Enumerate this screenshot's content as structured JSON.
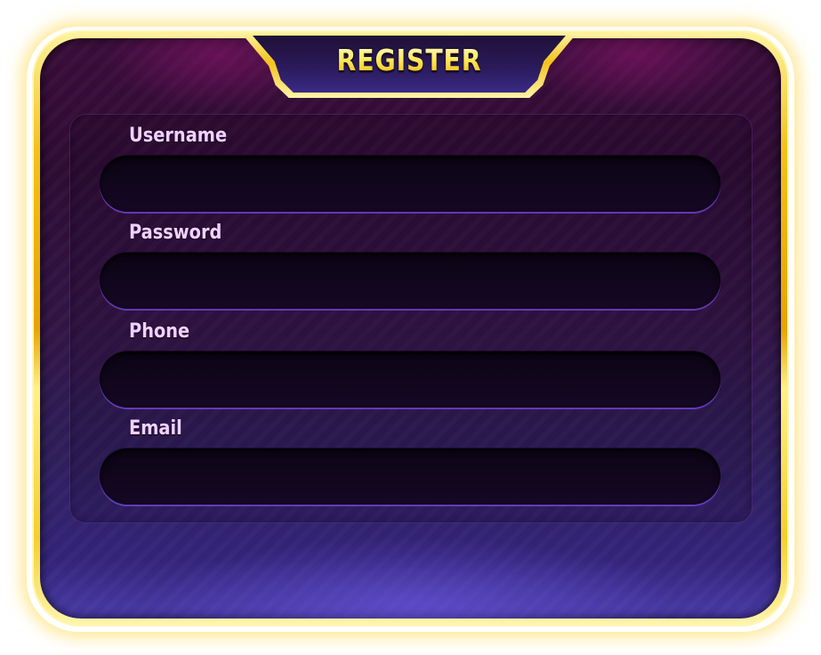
{
  "dialog": {
    "title": "REGISTER"
  },
  "fields": [
    {
      "label": "Username",
      "value": "",
      "placeholder": ""
    },
    {
      "label": "Password",
      "value": "",
      "placeholder": ""
    },
    {
      "label": "Phone",
      "value": "",
      "placeholder": ""
    },
    {
      "label": "Email",
      "value": "",
      "placeholder": ""
    }
  ],
  "colors": {
    "frame_gold": "#f2c21c",
    "title_text": "#fff27a",
    "label_text": "#efd2ff",
    "panel_top": "#3a0d3a",
    "panel_bottom": "#4a3aa8",
    "input_bg": "#0c0414",
    "input_glow": "#7846dc"
  }
}
